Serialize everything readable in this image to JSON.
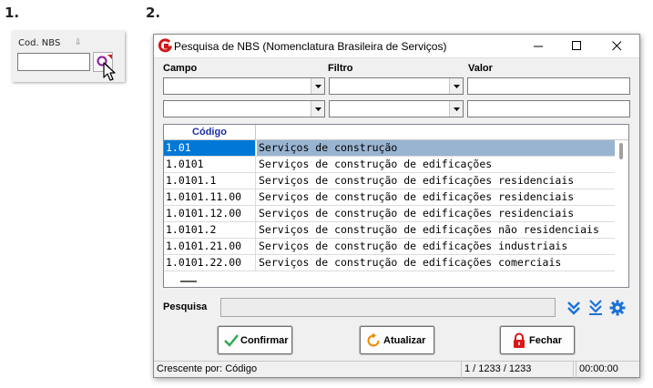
{
  "steps": {
    "first": "1.",
    "second": "2."
  },
  "field_panel": {
    "label": "Cod. NBS"
  },
  "dialog": {
    "title": "Pesquisa de NBS (Nomenclatura Brasileira de Serviços)",
    "filter_headers": {
      "campo": "Campo",
      "filtro": "Filtro",
      "valor": "Valor"
    },
    "grid": {
      "columns": [
        "Código",
        ""
      ],
      "rows": [
        {
          "code": "1.01",
          "desc": "Serviços de construção"
        },
        {
          "code": "1.0101",
          "desc": "Serviços de construção de edificações"
        },
        {
          "code": "1.0101.1",
          "desc": "Serviços de construção de edificações residenciais"
        },
        {
          "code": "1.0101.11.00",
          "desc": "Serviços de construção de edificações residenciais"
        },
        {
          "code": "1.0101.12.00",
          "desc": "Serviços de construção de edificações residenciais"
        },
        {
          "code": "1.0101.2",
          "desc": "Serviços de construção de edificações não residenciais"
        },
        {
          "code": "1.0101.21.00",
          "desc": "Serviços de construção de edificações industriais"
        },
        {
          "code": "1.0101.22.00",
          "desc": "Serviços de construção de edificações comerciais"
        }
      ],
      "selected_index": 0
    },
    "search_label": "Pesquisa",
    "buttons": {
      "confirm": "Confirmar",
      "refresh": "Atualizar",
      "close": "Fechar"
    },
    "status": {
      "sort": "Crescente por: Código",
      "count": "1 / 1233 / 1233",
      "time": "00:00:00"
    }
  },
  "colors": {
    "selection": "#0078d7",
    "selection_row": "#99b4d1",
    "header_text": "#1c2ea6",
    "accent_icon": "#1a73d9"
  },
  "icons": [
    "app-g-icon",
    "search-magnifier-icon",
    "mouse-cursor-icon",
    "checkmark-icon",
    "refresh-icon",
    "lock-icon",
    "chevron-double-down-icon",
    "gear-icon"
  ]
}
